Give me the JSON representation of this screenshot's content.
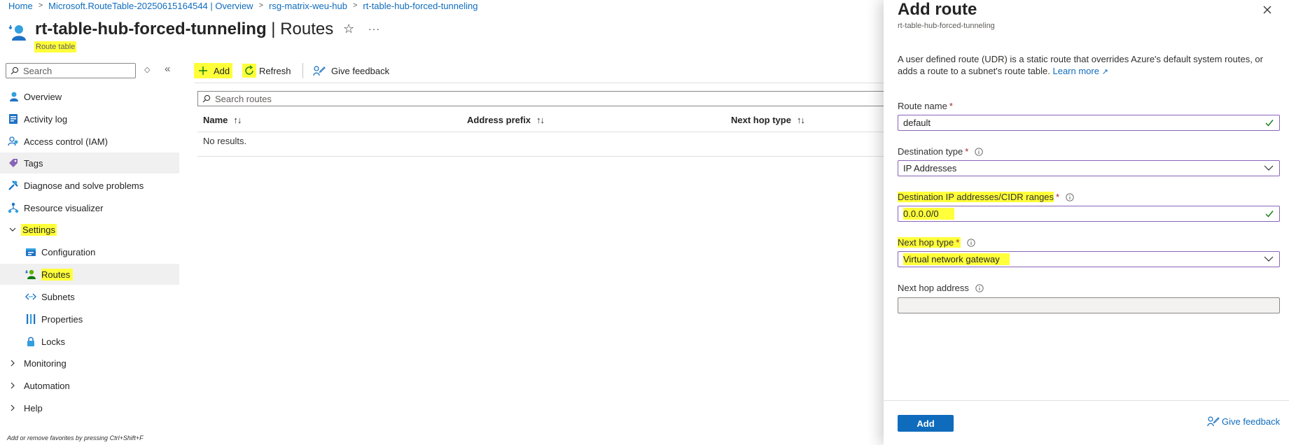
{
  "breadcrumb": [
    "Home",
    "Microsoft.RouteTable-20250615164544 | Overview",
    "rsg-matrix-weu-hub",
    "rt-table-hub-forced-tunneling"
  ],
  "header": {
    "resource_name": "rt-table-hub-forced-tunneling",
    "section": "Routes",
    "separator": "|",
    "subtitle": "Route table",
    "favorite_glyph": "☆",
    "more_glyph": "···"
  },
  "sidebar": {
    "search_placeholder": "Search",
    "items": [
      {
        "label": "Overview",
        "icon": "overview-icon"
      },
      {
        "label": "Activity log",
        "icon": "activity-log-icon"
      },
      {
        "label": "Access control (IAM)",
        "icon": "iam-icon"
      },
      {
        "label": "Tags",
        "icon": "tag-icon"
      },
      {
        "label": "Diagnose and solve problems",
        "icon": "diagnose-icon"
      },
      {
        "label": "Resource visualizer",
        "icon": "visualizer-icon"
      },
      {
        "label": "Settings",
        "expanded": true
      },
      {
        "label": "Configuration",
        "icon": "configuration-icon"
      },
      {
        "label": "Routes",
        "icon": "routes-icon",
        "selected": true
      },
      {
        "label": "Subnets",
        "icon": "subnets-icon"
      },
      {
        "label": "Properties",
        "icon": "properties-icon"
      },
      {
        "label": "Locks",
        "icon": "lock-icon"
      },
      {
        "label": "Monitoring",
        "expanded": false
      },
      {
        "label": "Automation",
        "expanded": false
      },
      {
        "label": "Help",
        "expanded": false
      }
    ],
    "footer_hint": "Add or remove favorites by pressing Ctrl+Shift+F"
  },
  "toolbar": {
    "add_label": "Add",
    "refresh_label": "Refresh",
    "feedback_label": "Give feedback"
  },
  "routes": {
    "search_placeholder": "Search routes",
    "columns": [
      "Name",
      "Address prefix",
      "Next hop type"
    ],
    "sort_glyph": "↑↓",
    "empty_text": "No results."
  },
  "panel": {
    "title": "Add route",
    "subtitle": "rt-table-hub-forced-tunneling",
    "description": "A user defined route (UDR) is a static route that overrides Azure's default system routes, or adds a route to a subnet's route table.",
    "learn_more": "Learn more",
    "fields": {
      "route_name": {
        "label": "Route name",
        "value": "default",
        "required": true
      },
      "destination_type": {
        "label": "Destination type",
        "value": "IP Addresses",
        "required": true
      },
      "destination_ip": {
        "label": "Destination IP addresses/CIDR ranges",
        "value": "0.0.0.0/0",
        "required": true
      },
      "next_hop_type": {
        "label": "Next hop type",
        "value": "Virtual network gateway",
        "required": true
      },
      "next_hop_address": {
        "label": "Next hop address",
        "value": ""
      }
    },
    "required_mark": "*",
    "add_button": "Add",
    "feedback_label": "Give feedback"
  },
  "colors": {
    "accent": "#0f6cbd",
    "highlight": "#ffff3a",
    "field_border": "#8764b8",
    "valid_check": "#107c10",
    "required": "#a4262c"
  }
}
